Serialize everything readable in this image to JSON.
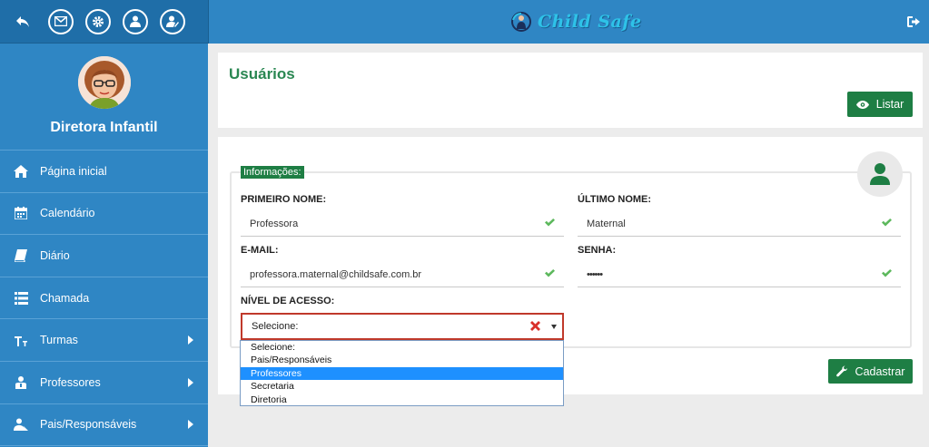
{
  "brand": {
    "name": "Child Safe"
  },
  "topbar": {
    "icons": [
      "back-icon",
      "mail-icon",
      "gear-icon",
      "user-icon",
      "user-edit-icon"
    ],
    "logout_icon": "logout-icon"
  },
  "profile": {
    "name": "Diretora Infantil"
  },
  "sidebar": {
    "items": [
      {
        "label": "Página inicial",
        "icon": "home-icon",
        "submenu": false
      },
      {
        "label": "Calendário",
        "icon": "calendar-icon",
        "submenu": false
      },
      {
        "label": "Diário",
        "icon": "book-icon",
        "submenu": false
      },
      {
        "label": "Chamada",
        "icon": "list-icon",
        "submenu": false
      },
      {
        "label": "Turmas",
        "icon": "text-height-icon",
        "submenu": true
      },
      {
        "label": "Professores",
        "icon": "teacher-icon",
        "submenu": true
      },
      {
        "label": "Pais/Responsáveis",
        "icon": "parents-icon",
        "submenu": true
      }
    ]
  },
  "page": {
    "title": "Usuários",
    "list_button": "Listar",
    "legend": "Informações:",
    "fields": {
      "first_name_label": "PRIMEIRO NOME:",
      "first_name_value": "Professora",
      "last_name_label": "ÚLTIMO NOME:",
      "last_name_value": "Maternal",
      "email_label": "E-MAIL:",
      "email_value": "professora.maternal@childsafe.com.br",
      "password_label": "SENHA:",
      "password_value": "••••••",
      "access_label": "NÍVEL DE ACESSO:",
      "access_value": "Selecione:"
    },
    "dropdown_options": [
      "Selecione:",
      "Pais/Responsáveis",
      "Professores",
      "Secretaria",
      "Diretoria"
    ],
    "dropdown_highlighted": "Professores",
    "submit_button": "Cadastrar"
  },
  "colors": {
    "sidebar": "#2f86c4",
    "header": "#2f86c4",
    "accent_green": "#1e7e44",
    "title_green": "#2a8752",
    "error_red": "#c0392b",
    "valid_green": "#5cb85c",
    "highlight_blue": "#1e90ff"
  }
}
